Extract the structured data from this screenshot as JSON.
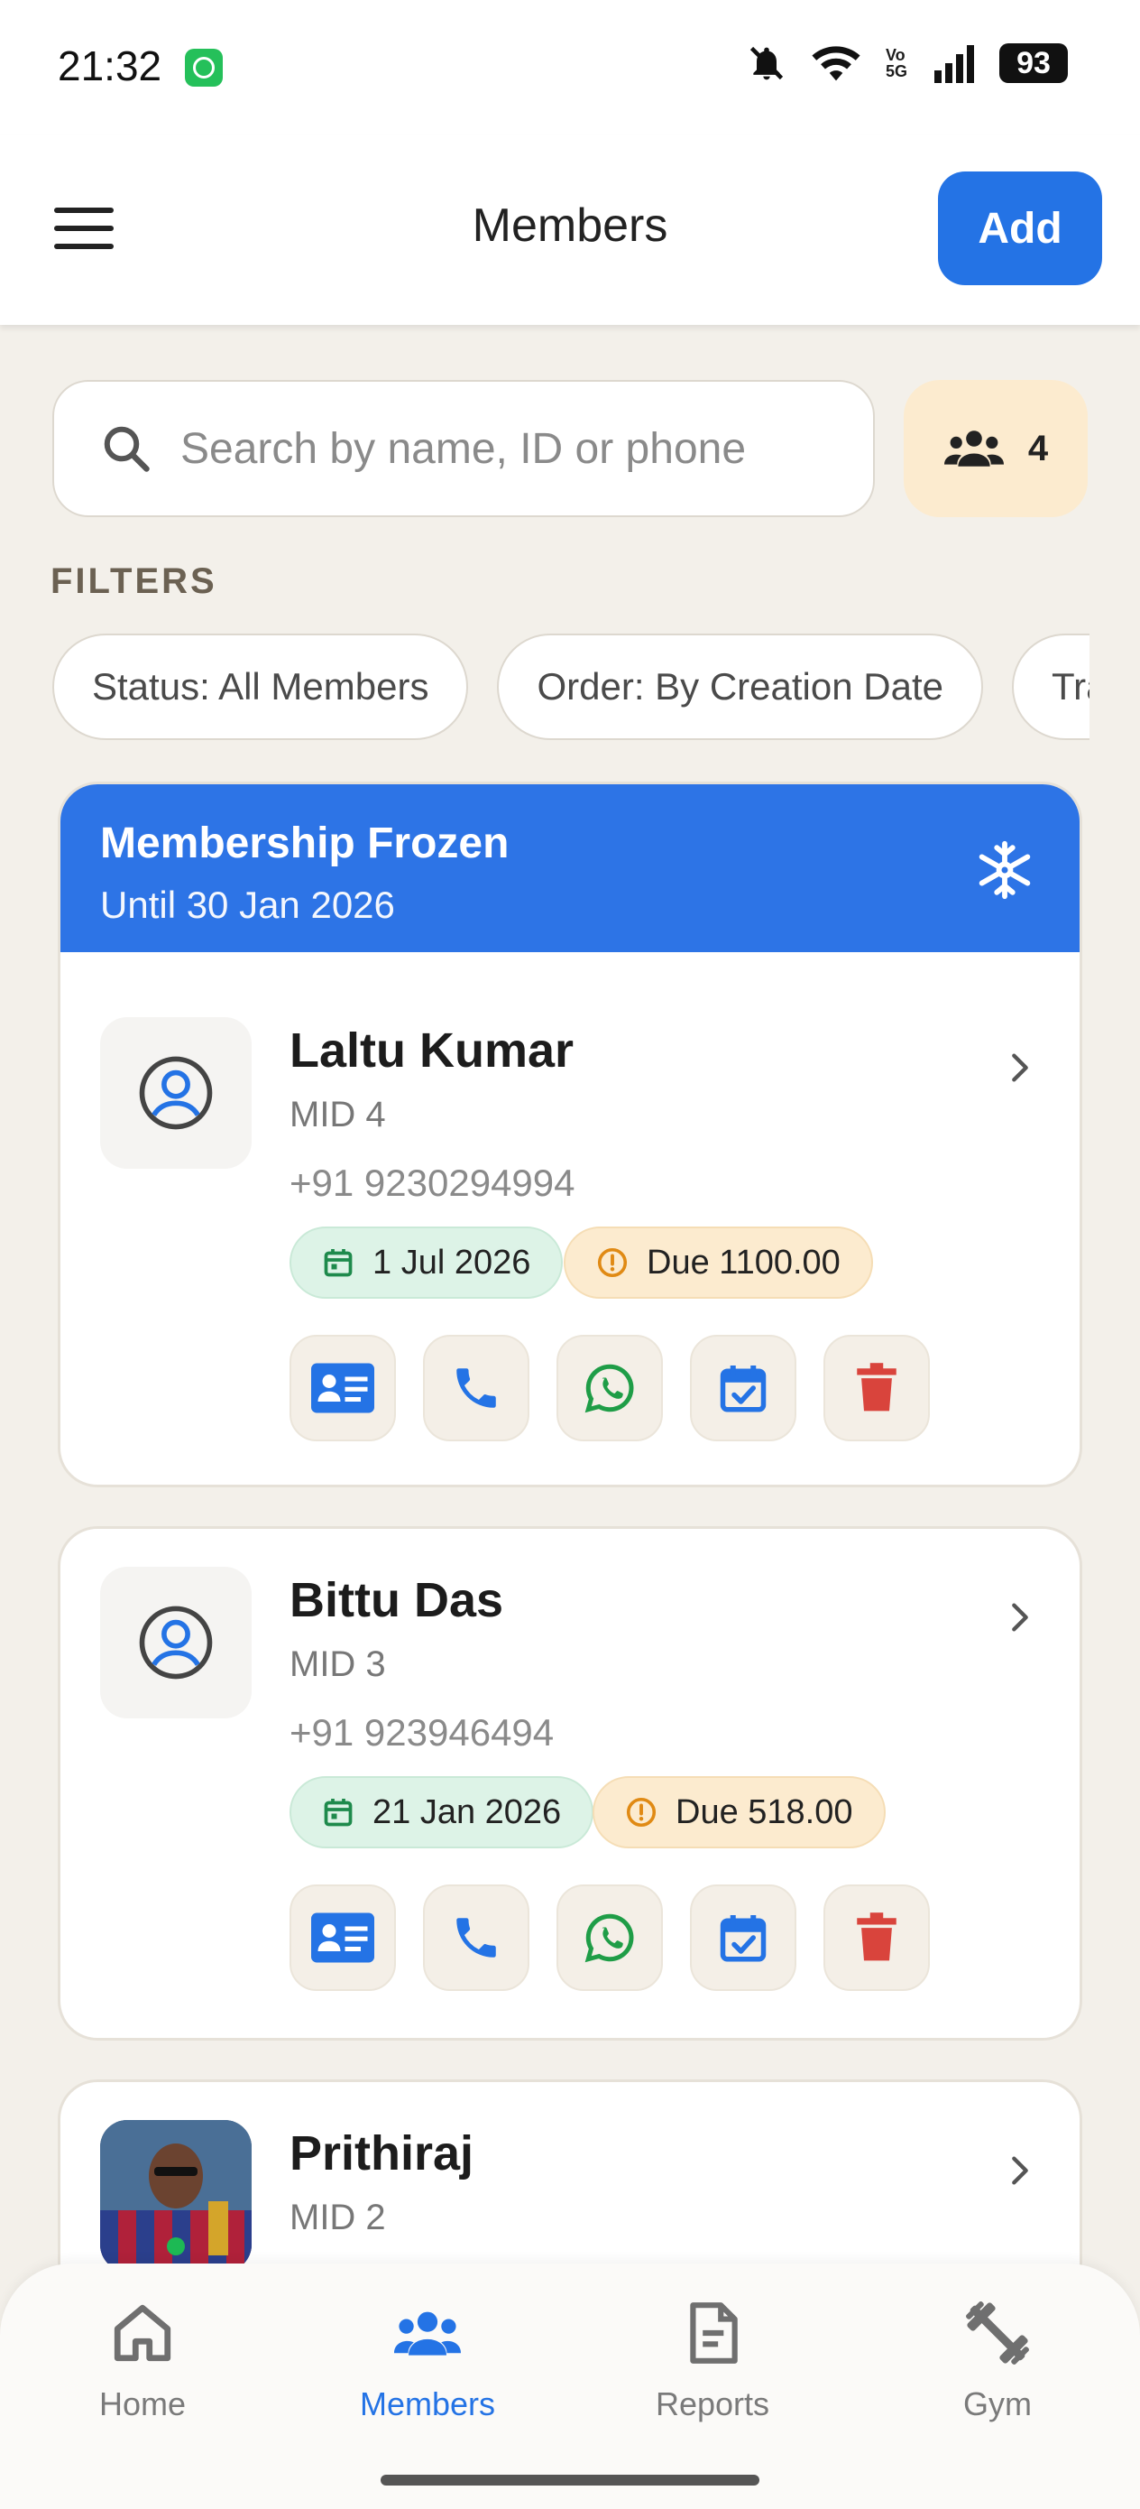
{
  "status_bar": {
    "time": "21:32",
    "battery": "93",
    "network": "Vo 5G"
  },
  "app_bar": {
    "title": "Members",
    "add_label": "Add"
  },
  "search": {
    "placeholder": "Search by name, ID or phone",
    "member_count": "4"
  },
  "filters": {
    "label": "FILTERS",
    "chips": [
      "Status: All Members",
      "Order: By Creation Date",
      "Tra"
    ]
  },
  "members": [
    {
      "frozen_title": "Membership Frozen",
      "frozen_until": "Until 30 Jan 2026",
      "name": "Laltu Kumar",
      "mid": "MID 4",
      "phone": "+91 9230294994",
      "date": "1 Jul 2026",
      "due": "Due 1100.00"
    },
    {
      "name": "Bittu Das",
      "mid": "MID 3",
      "phone": "+91 923946494",
      "date": "21 Jan 2026",
      "due": "Due 518.00"
    },
    {
      "name": "Prithiraj",
      "mid": "MID 2"
    }
  ],
  "nav": {
    "home": "Home",
    "members": "Members",
    "reports": "Reports",
    "gym": "Gym"
  },
  "colors": {
    "accent": "#2473e5",
    "background": "#f3f0ea",
    "date_pill": "#ddf3e7",
    "due_pill": "#fcebcf",
    "whatsapp": "#1f9d47",
    "delete": "#d9443c"
  },
  "icons": [
    "menu-icon",
    "search-icon",
    "group-icon",
    "snowflake-icon",
    "user-circle-icon",
    "chevron-right-icon",
    "calendar-icon",
    "alert-icon",
    "id-card-icon",
    "phone-icon",
    "whatsapp-icon",
    "calendar-check-icon",
    "trash-icon",
    "home-icon",
    "members-icon",
    "reports-icon",
    "gym-icon"
  ]
}
